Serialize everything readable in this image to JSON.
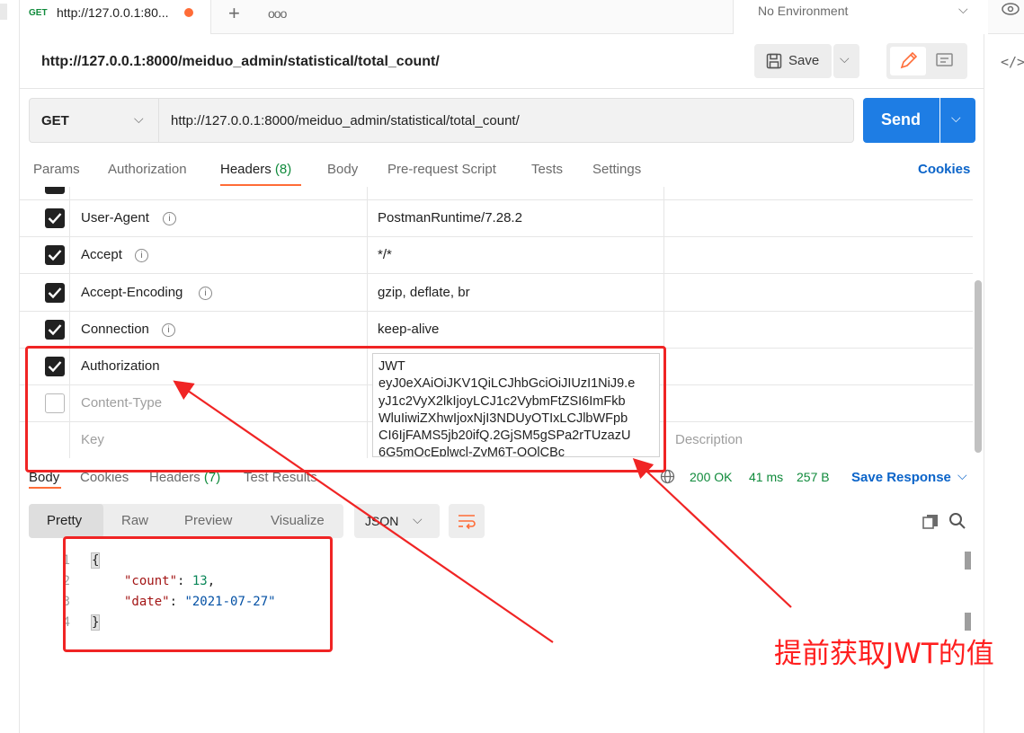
{
  "tab": {
    "method": "GET",
    "title": "http://127.0.0.1:80..."
  },
  "environment": {
    "label": "No Environment"
  },
  "request": {
    "title": "http://127.0.0.1:8000/meiduo_admin/statistical/total_count/",
    "method": "GET",
    "url": "http://127.0.0.1:8000/meiduo_admin/statistical/total_count/",
    "save_label": "Save",
    "send_label": "Send"
  },
  "request_tabs": {
    "params": "Params",
    "authorization": "Authorization",
    "headers": "Headers",
    "headers_count": "(8)",
    "body": "Body",
    "prerequest": "Pre-request Script",
    "tests": "Tests",
    "settings": "Settings",
    "cookies": "Cookies"
  },
  "headers": {
    "rows": [
      {
        "key": "User-Agent",
        "value": "PostmanRuntime/7.28.2",
        "checked": true
      },
      {
        "key": "Accept",
        "value": "*/*",
        "checked": true
      },
      {
        "key": "Accept-Encoding",
        "value": "gzip, deflate, br",
        "checked": true
      },
      {
        "key": "Connection",
        "value": "keep-alive",
        "checked": true
      },
      {
        "key": "Authorization",
        "value": "JWT eyJ0eXAiOiJKV1QiLCJhbGciOiJIUzI1NiJ9.eyJ1c2VyX2lkIjoyLCJ1c2VybmFtZSI6ImFkbWluIiwiZXhwIjoxNjI3NDUyOTIxLCJlbWFpbCI6IjFAMS5jb20ifQ.2GjSM5gSPa2rTUzazU6G5mQcEplwcl-ZyM6T-OOlCBc",
        "checked": true
      },
      {
        "key": "Content-Type",
        "value": "",
        "checked": false
      }
    ],
    "jwt_lines": [
      "JWT",
      "eyJ0eXAiOiJKV1QiLCJhbGciOiJIUzI1NiJ9.e",
      "yJ1c2VyX2lkIjoyLCJ1c2VybmFtZSI6ImFkb",
      "WluIiwiZXhwIjoxNjI3NDUyOTIxLCJlbWFpb",
      "CI6IjFAMS5jb20ifQ.2GjSM5gSPa2rTUzazU",
      "6G5mQcEplwcl-ZyM6T-OOlCBc"
    ],
    "key_placeholder": "Key",
    "description_placeholder": "Description"
  },
  "response": {
    "tabs": {
      "body": "Body",
      "cookies": "Cookies",
      "headers": "Headers",
      "headers_count": "(7)",
      "tests": "Test Results"
    },
    "status": "200 OK",
    "time": "41 ms",
    "size": "257 B",
    "save_response": "Save Response",
    "views": {
      "pretty": "Pretty",
      "raw": "Raw",
      "preview": "Preview",
      "visualize": "Visualize"
    },
    "format": "JSON",
    "body": {
      "line_numbers": [
        "1",
        "2",
        "3",
        "4"
      ],
      "open_brace": "{",
      "close_brace": "}",
      "count_key": "\"count\"",
      "count_value": "13",
      "date_key": "\"date\"",
      "date_value": "\"2021-07-27\""
    }
  },
  "annotation": {
    "text": "提前获取JWT的值",
    "color": "#ff1f1f"
  },
  "colors": {
    "accent": "#ff6c37",
    "send": "#1e7de4",
    "link": "#0b64c9",
    "ok": "#0f8a3b",
    "annotation": "#f02424"
  }
}
